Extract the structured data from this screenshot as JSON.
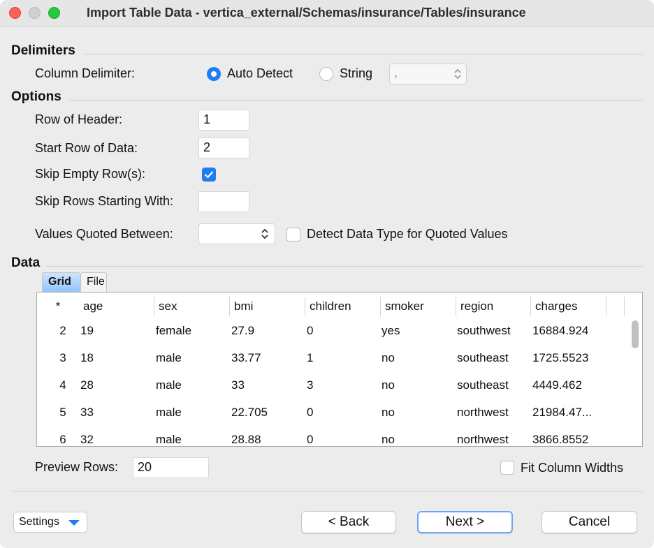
{
  "window": {
    "title": "Import Table Data - vertica_external/Schemas/insurance/Tables/insurance"
  },
  "delimiters": {
    "heading": "Delimiters",
    "column_delimiter_label": "Column Delimiter:",
    "auto_detect_label": "Auto Detect",
    "string_label": "String",
    "string_value": ",",
    "selected": "Auto Detect"
  },
  "options": {
    "heading": "Options",
    "row_of_header_label": "Row of Header:",
    "row_of_header_value": "1",
    "start_row_label": "Start Row of Data:",
    "start_row_value": "2",
    "skip_empty_label": "Skip Empty Row(s):",
    "skip_empty_checked": true,
    "skip_rows_label": "Skip Rows Starting With:",
    "skip_rows_value": "",
    "quoted_label": "Values Quoted Between:",
    "quoted_value": "",
    "detect_type_label": "Detect Data Type for Quoted Values",
    "detect_type_checked": false
  },
  "data": {
    "heading": "Data",
    "tabs": [
      "Grid",
      "File"
    ],
    "active_tab": "Grid",
    "columns": [
      "*",
      "age",
      "sex",
      "bmi",
      "children",
      "smoker",
      "region",
      "charges"
    ],
    "rows": [
      [
        "2",
        "19",
        "female",
        "27.9",
        "0",
        "yes",
        "southwest",
        "16884.924"
      ],
      [
        "3",
        "18",
        "male",
        "33.77",
        "1",
        "no",
        "southeast",
        "1725.5523"
      ],
      [
        "4",
        "28",
        "male",
        "33",
        "3",
        "no",
        "southeast",
        "4449.462"
      ],
      [
        "5",
        "33",
        "male",
        "22.705",
        "0",
        "no",
        "northwest",
        "21984.47..."
      ],
      [
        "6",
        "32",
        "male",
        "28.88",
        "0",
        "no",
        "northwest",
        "3866.8552"
      ]
    ],
    "preview_rows_label": "Preview Rows:",
    "preview_rows_value": "20",
    "fit_widths_label": "Fit Column Widths",
    "fit_widths_checked": false
  },
  "footer": {
    "settings_label": "Settings",
    "back_label": "< Back",
    "next_label": "Next >",
    "cancel_label": "Cancel"
  },
  "colors": {
    "accent": "#1f7cf5",
    "close": "#fe5f57",
    "maximize": "#27c840"
  }
}
